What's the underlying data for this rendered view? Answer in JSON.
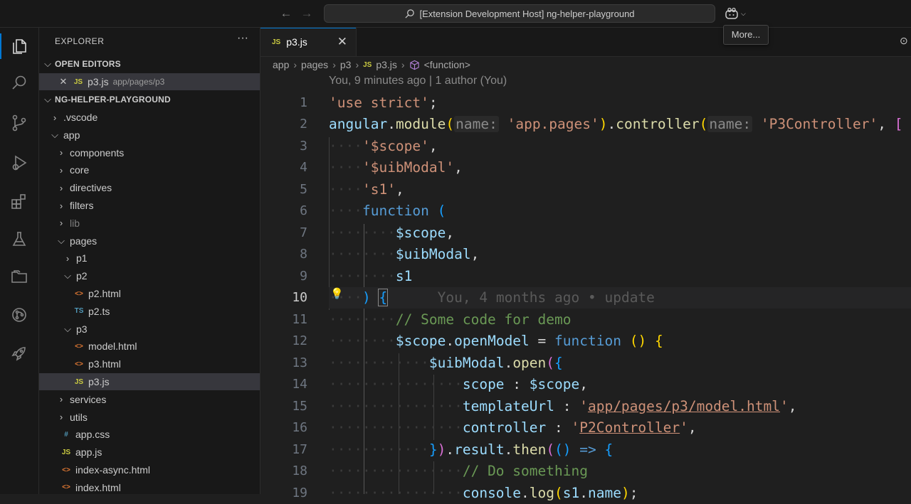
{
  "titlebar": {
    "back_icon": "arrow-left-icon",
    "forward_icon": "arrow-right-icon",
    "command_center": "[Extension Development Host] ng-helper-playground",
    "copilot_icon": "copilot-icon",
    "tooltip": "More..."
  },
  "activity_bar": [
    "explorer-icon",
    "search-icon",
    "source-control-icon",
    "run-debug-icon",
    "extensions-icon",
    "testing-icon",
    "folder-icon",
    "remote-icon",
    "rocket-icon"
  ],
  "sidebar": {
    "title": "EXPLORER",
    "more": "···",
    "open_editors": {
      "label": "OPEN EDITORS",
      "items": [
        {
          "close": "✕",
          "icon": "JS",
          "name": "p3.js",
          "path": "app/pages/p3"
        }
      ]
    },
    "project": {
      "label": "NG-HELPER-PLAYGROUND",
      "tree": [
        {
          "name": ".vscode",
          "type": "folder",
          "open": false,
          "depth": 1
        },
        {
          "name": "app",
          "type": "folder",
          "open": true,
          "depth": 1
        },
        {
          "name": "components",
          "type": "folder",
          "open": false,
          "depth": 2
        },
        {
          "name": "core",
          "type": "folder",
          "open": false,
          "depth": 2
        },
        {
          "name": "directives",
          "type": "folder",
          "open": false,
          "depth": 2
        },
        {
          "name": "filters",
          "type": "folder",
          "open": false,
          "depth": 2
        },
        {
          "name": "lib",
          "type": "folder",
          "open": false,
          "depth": 2,
          "dim": true
        },
        {
          "name": "pages",
          "type": "folder",
          "open": true,
          "depth": 2
        },
        {
          "name": "p1",
          "type": "folder",
          "open": false,
          "depth": 3
        },
        {
          "name": "p2",
          "type": "folder",
          "open": true,
          "depth": 3
        },
        {
          "name": "p2.html",
          "type": "html",
          "depth": 4
        },
        {
          "name": "p2.ts",
          "type": "ts",
          "depth": 4
        },
        {
          "name": "p3",
          "type": "folder",
          "open": true,
          "depth": 3
        },
        {
          "name": "model.html",
          "type": "html",
          "depth": 4
        },
        {
          "name": "p3.html",
          "type": "html",
          "depth": 4
        },
        {
          "name": "p3.js",
          "type": "js",
          "depth": 4,
          "selected": true
        },
        {
          "name": "services",
          "type": "folder",
          "open": false,
          "depth": 2
        },
        {
          "name": "utils",
          "type": "folder",
          "open": false,
          "depth": 2
        },
        {
          "name": "app.css",
          "type": "css",
          "depth": 2
        },
        {
          "name": "app.js",
          "type": "js",
          "depth": 2
        },
        {
          "name": "index-async.html",
          "type": "html",
          "depth": 2
        },
        {
          "name": "index.html",
          "type": "html",
          "depth": 2
        }
      ]
    }
  },
  "editor": {
    "tab": {
      "icon": "JS",
      "name": "p3.js",
      "close": "✕"
    },
    "actions_icon": "compare-icon",
    "breadcrumbs": [
      "app",
      "pages",
      "p3",
      "p3.js",
      "<function>"
    ],
    "blame_header": "You, 9 minutes ago | 1 author (You)",
    "inline_blame": "You, 4 months ago • update",
    "current_line": 10,
    "line_numbers": [
      1,
      2,
      3,
      4,
      5,
      6,
      7,
      8,
      9,
      10,
      11,
      12,
      13,
      14,
      15,
      16,
      17,
      18,
      19
    ]
  }
}
